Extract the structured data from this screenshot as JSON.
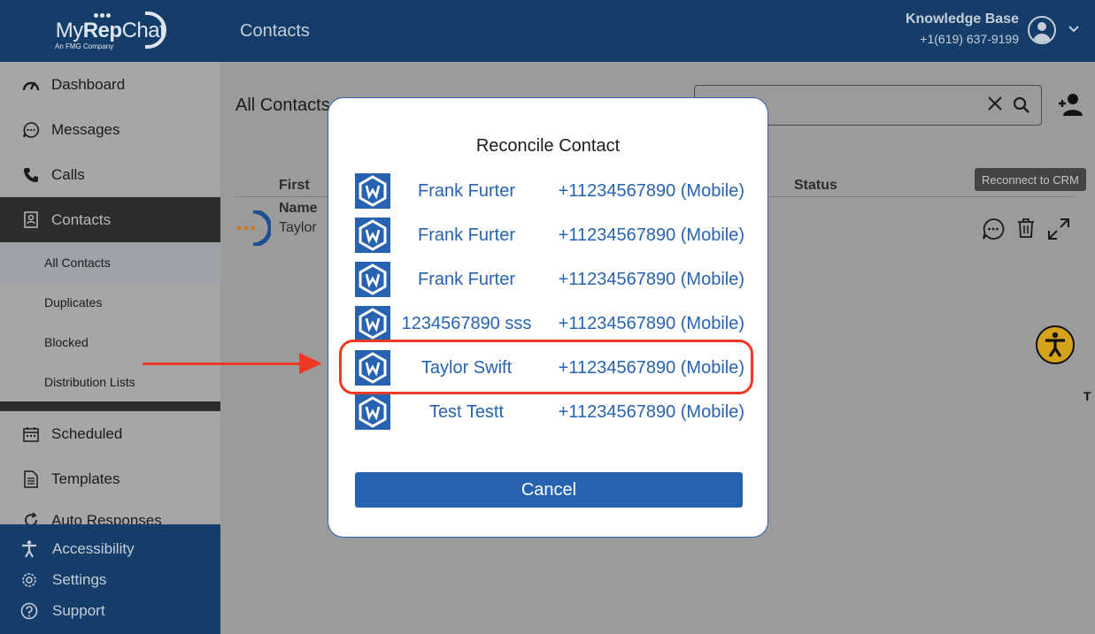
{
  "logo": {
    "part1": "My",
    "part2": "Rep",
    "part3": "Chat",
    "subtitle": "An FMG Company"
  },
  "sidebar": {
    "items": [
      {
        "label": "Dashboard",
        "icon": "gauge-icon"
      },
      {
        "label": "Messages",
        "icon": "chat-bubble-icon"
      },
      {
        "label": "Calls",
        "icon": "phone-icon"
      },
      {
        "label": "Contacts",
        "icon": "contacts-book-icon"
      }
    ],
    "contact_subitems": [
      "All Contacts",
      "Duplicates",
      "Blocked",
      "Distribution Lists"
    ],
    "more_items": [
      {
        "label": "Scheduled",
        "icon": "calendar-icon"
      },
      {
        "label": "Templates",
        "icon": "document-icon"
      },
      {
        "label": "Auto Responses",
        "icon": "refresh-icon"
      }
    ],
    "bottom_items": [
      {
        "label": "Accessibility",
        "icon": "accessibility-icon"
      },
      {
        "label": "Settings",
        "icon": "gear-icon"
      },
      {
        "label": "Support",
        "icon": "help-icon"
      }
    ]
  },
  "header": {
    "title": "Contacts",
    "user_name": "Knowledge Base",
    "user_phone": "+1(619) 637-9199"
  },
  "main": {
    "title": "All Contacts",
    "columns": {
      "first": "First",
      "status": "Status"
    },
    "tooltip": "Reconnect to CRM",
    "row": {
      "name_label": "Name",
      "name": "Taylor"
    }
  },
  "modal": {
    "title": "Reconcile Contact",
    "contacts": [
      {
        "name": "Frank Furter",
        "phone": "+11234567890 (Mobile)"
      },
      {
        "name": "Frank Furter",
        "phone": "+11234567890 (Mobile)"
      },
      {
        "name": "Frank Furter",
        "phone": "+11234567890 (Mobile)"
      },
      {
        "name": "1234567890 sss",
        "phone": "+11234567890 (Mobile)"
      },
      {
        "name": "Taylor Swift",
        "phone": "+11234567890 (Mobile)"
      },
      {
        "name": "Test Testt",
        "phone": "+11234567890 (Mobile)"
      }
    ],
    "cancel_label": "Cancel"
  },
  "misc": {
    "stray_letter": "T"
  },
  "colors": {
    "brand_navy": "#153d6a",
    "link_blue": "#2763b0",
    "annotation_red": "#ee3a24"
  }
}
